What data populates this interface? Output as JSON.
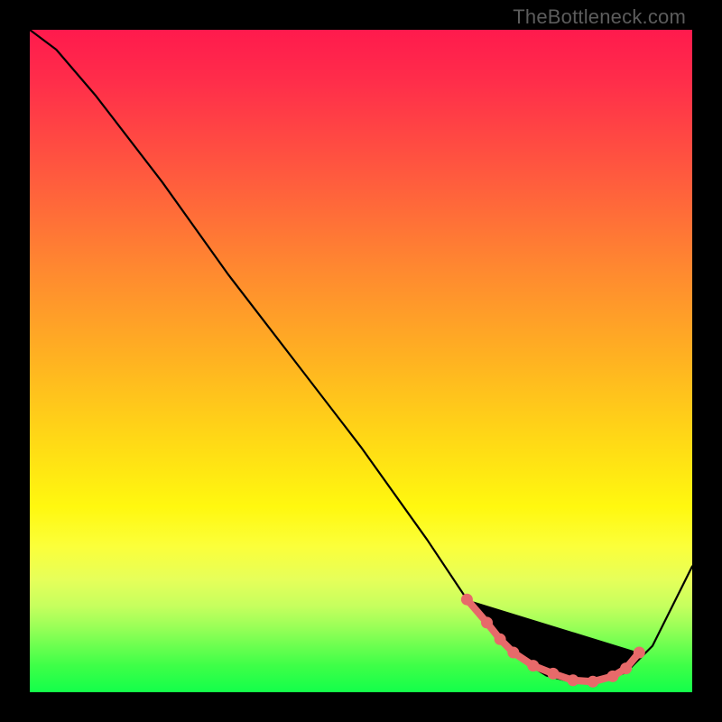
{
  "watermark": "TheBottleneck.com",
  "chart_data": {
    "type": "line",
    "title": "",
    "xlabel": "",
    "ylabel": "",
    "xlim": [
      0,
      100
    ],
    "ylim": [
      0,
      100
    ],
    "series": [
      {
        "name": "curve",
        "x": [
          0,
          4,
          10,
          20,
          30,
          40,
          50,
          60,
          66,
          70,
          74,
          78,
          82,
          86,
          90,
          94,
          100
        ],
        "y": [
          100,
          97,
          90,
          77,
          63,
          50,
          37,
          23,
          14,
          9,
          5,
          2.5,
          1.5,
          1.5,
          3,
          7,
          19
        ]
      }
    ],
    "markers": {
      "name": "highlight-dots",
      "color": "#e76a6a",
      "x": [
        66,
        69,
        71,
        73,
        76,
        79,
        82,
        85,
        88,
        90,
        92
      ],
      "y": [
        14,
        10.5,
        8,
        6,
        4,
        2.8,
        1.8,
        1.6,
        2.4,
        3.6,
        6
      ]
    }
  }
}
